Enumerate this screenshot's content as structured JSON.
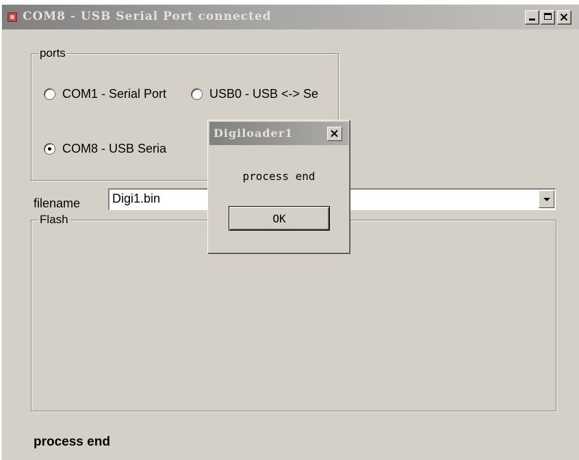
{
  "window": {
    "title": "COM8 - USB Serial Port connected"
  },
  "ports": {
    "group_label": "ports",
    "options": [
      {
        "label": "COM1 - Serial Port",
        "selected": false
      },
      {
        "label": "USB0 - USB <-> Se",
        "selected": false
      },
      {
        "label": "COM8 - USB Seria",
        "selected": true
      }
    ]
  },
  "filename": {
    "label": "filename",
    "value": "Digi1.bin"
  },
  "flash": {
    "group_label": "Flash"
  },
  "status": {
    "text": "process end"
  },
  "dialog": {
    "title": "Digiloader1",
    "message": "process end",
    "ok_label": "OK"
  }
}
